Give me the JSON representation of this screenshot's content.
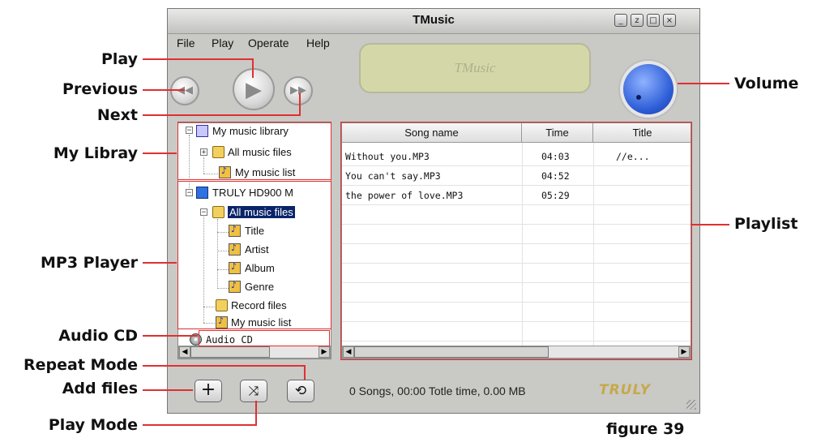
{
  "window": {
    "title": "TMusic",
    "controls": [
      "_",
      "z",
      "□",
      "×"
    ]
  },
  "menu": [
    "File",
    "Play",
    "Operate",
    "Help"
  ],
  "display": {
    "text": "TMusic"
  },
  "tree": {
    "library": "My music library",
    "all_music_files": "All music files",
    "my_music_list": "My music list",
    "device": "TRULY HD900 M",
    "device_all": "All music files",
    "title": "Title",
    "artist": "Artist",
    "album": "Album",
    "genre": "Genre",
    "record_files": "Record files",
    "device_list": "My music list",
    "audio_cd": "Audio CD"
  },
  "playlist": {
    "columns": [
      "Song name",
      "Time",
      "Title"
    ],
    "rows": [
      {
        "name": "Without you.MP3",
        "time": "04:03",
        "title": "//e..."
      },
      {
        "name": "You can't say.MP3",
        "time": "04:52",
        "title": ""
      },
      {
        "name": "the power of love.MP3",
        "time": "05:29",
        "title": ""
      }
    ]
  },
  "status": "0 Songs, 00:00 Totle time, 0.00 MB",
  "brand": "TRULY",
  "callouts": {
    "play": "Play",
    "previous": "Previous",
    "next": "Next",
    "my_library": "My Libray",
    "mp3_player": "MP3 Player",
    "audio_cd": "Audio CD",
    "repeat_mode": "Repeat Mode",
    "add_files": "Add files",
    "play_mode": "Play Mode",
    "volume": "Volume",
    "playlist": "Playlist"
  },
  "figure_label": "figure 39",
  "icons": {
    "previous": "rewind-icon",
    "play": "play-icon",
    "next": "fast-forward-icon",
    "add": "plus-icon",
    "shuffle": "shuffle-icon",
    "repeat": "repeat-icon",
    "volume": "volume-knob"
  },
  "colors": {
    "callout_line": "#e03030",
    "lcd": "#d4d8a9",
    "knob": "#2c5cd6",
    "brand": "#c6a94a"
  }
}
